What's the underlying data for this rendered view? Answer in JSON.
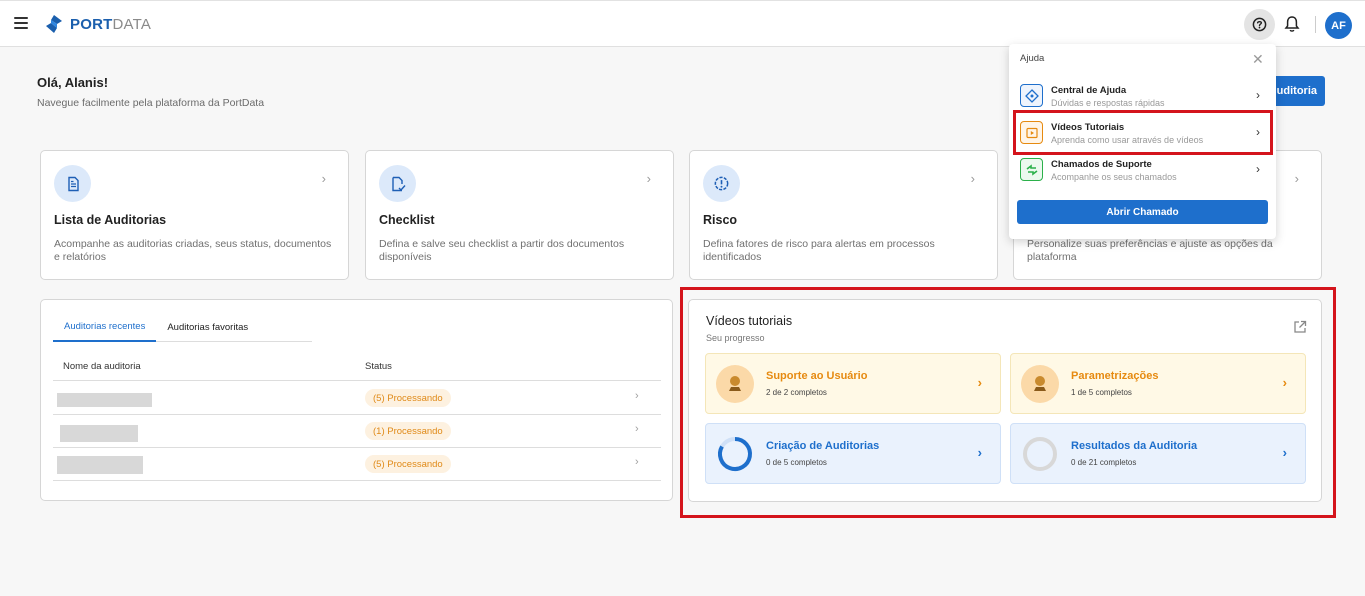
{
  "brand": {
    "name_bold": "PORT",
    "name_light": "DATA",
    "primary": "#1e6fcc",
    "accent": "#e68a10"
  },
  "header": {
    "avatar_initials": "AF",
    "help_icon": "help-circle-icon",
    "bell_icon": "bell-icon"
  },
  "greeting": {
    "title": "Olá, Alanis!",
    "subtitle": "Navegue facilmente pela plataforma da PortData"
  },
  "new_audit_button": {
    "label": "uditoria"
  },
  "cards": [
    {
      "title": "Lista de Auditorias",
      "desc": "Acompanhe as auditorias criadas, seus status, documentos e relatórios",
      "icon": "document-list-icon"
    },
    {
      "title": "Checklist",
      "desc": "Defina e salve seu checklist a partir dos documentos disponíveis",
      "icon": "checklist-icon"
    },
    {
      "title": "Risco",
      "desc": "Defina fatores de risco para alertas em processos identificados",
      "icon": "alert-icon"
    },
    {
      "title": "",
      "desc": "Personalize suas preferências e ajuste as opções da plataforma",
      "icon": "settings-icon"
    }
  ],
  "recent": {
    "tabs": [
      {
        "label": "Auditorias recentes",
        "active": true
      },
      {
        "label": "Auditorias favoritas",
        "active": false
      }
    ],
    "columns": {
      "name": "Nome da auditoria",
      "status": "Status"
    },
    "rows": [
      {
        "status": "(5) Processando"
      },
      {
        "status": "(1) Processando"
      },
      {
        "status": "(5) Processando"
      }
    ]
  },
  "videos": {
    "title": "Vídeos tutoriais",
    "subtitle": "Seu progresso",
    "items": [
      {
        "title": "Suporte ao Usuário",
        "progress": "2 de 2 completos",
        "completed": 2,
        "total": 2
      },
      {
        "title": "Parametrizações",
        "progress": "1 de 5 completos",
        "completed": 1,
        "total": 5
      },
      {
        "title": "Criação de Auditorias",
        "progress": "0 de 5 completos",
        "completed": 0,
        "total": 5
      },
      {
        "title": "Resultados da Auditoria",
        "progress": "0 de 21 completos",
        "completed": 0,
        "total": 21
      }
    ]
  },
  "help_menu": {
    "title": "Ajuda",
    "items": [
      {
        "title": "Central de Ajuda",
        "subtitle": "Dúvidas e respostas rápidas",
        "icon": "help-center-icon"
      },
      {
        "title": "Vídeos Tutoriais",
        "subtitle": "Aprenda como usar através de vídeos",
        "icon": "video-play-icon"
      },
      {
        "title": "Chamados de Suporte",
        "subtitle": "Acompanhe os seus chamados",
        "icon": "support-ticket-icon"
      }
    ],
    "button": "Abrir Chamado"
  }
}
